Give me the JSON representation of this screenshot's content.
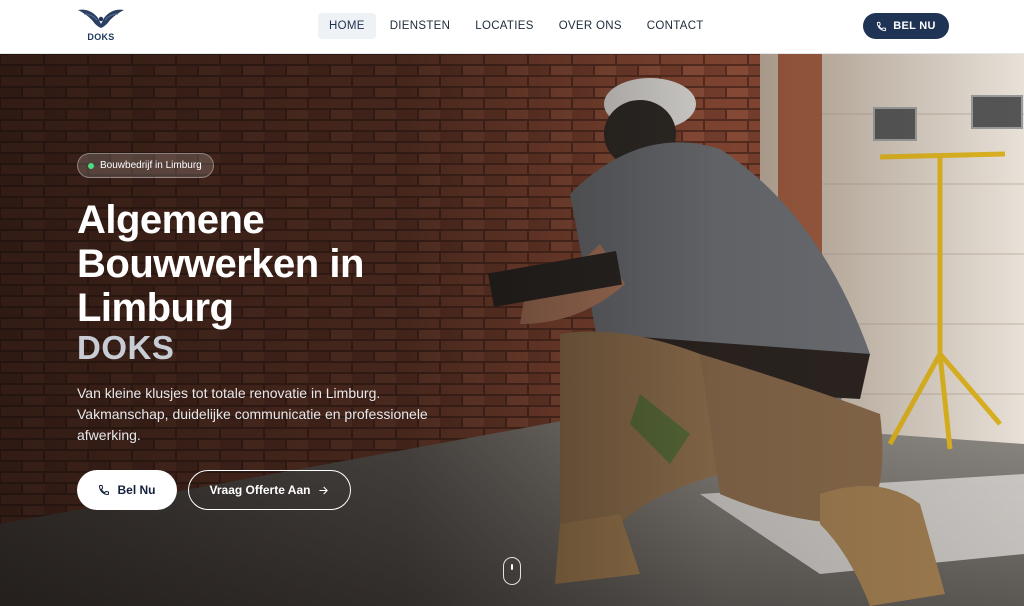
{
  "header": {
    "logo_text": "DOKS",
    "nav": [
      {
        "label": "HOME",
        "active": true
      },
      {
        "label": "DIENSTEN",
        "active": false
      },
      {
        "label": "LOCATIES",
        "active": false
      },
      {
        "label": "OVER ONS",
        "active": false
      },
      {
        "label": "CONTACT",
        "active": false
      }
    ],
    "call_button": "BEL NU"
  },
  "hero": {
    "badge": "Bouwbedrijf in Limburg",
    "title_lines": [
      "Algemene",
      "Bouwwerken in",
      "Limburg"
    ],
    "brand": "DOKS",
    "lead": "Van kleine klusjes tot totale renovatie in Limburg. Vakmanschap, duidelijke communicatie en professionele afwerking.",
    "primary_button": "Bel Nu",
    "secondary_button": "Vraag Offerte Aan"
  },
  "colors": {
    "navy": "#1f3354",
    "badge_dot": "#4ade80"
  },
  "icons": {
    "phone": "phone-icon",
    "arrow": "arrow-right-icon",
    "scroll": "mouse-scroll-icon",
    "logo": "eagle-logo-icon"
  }
}
